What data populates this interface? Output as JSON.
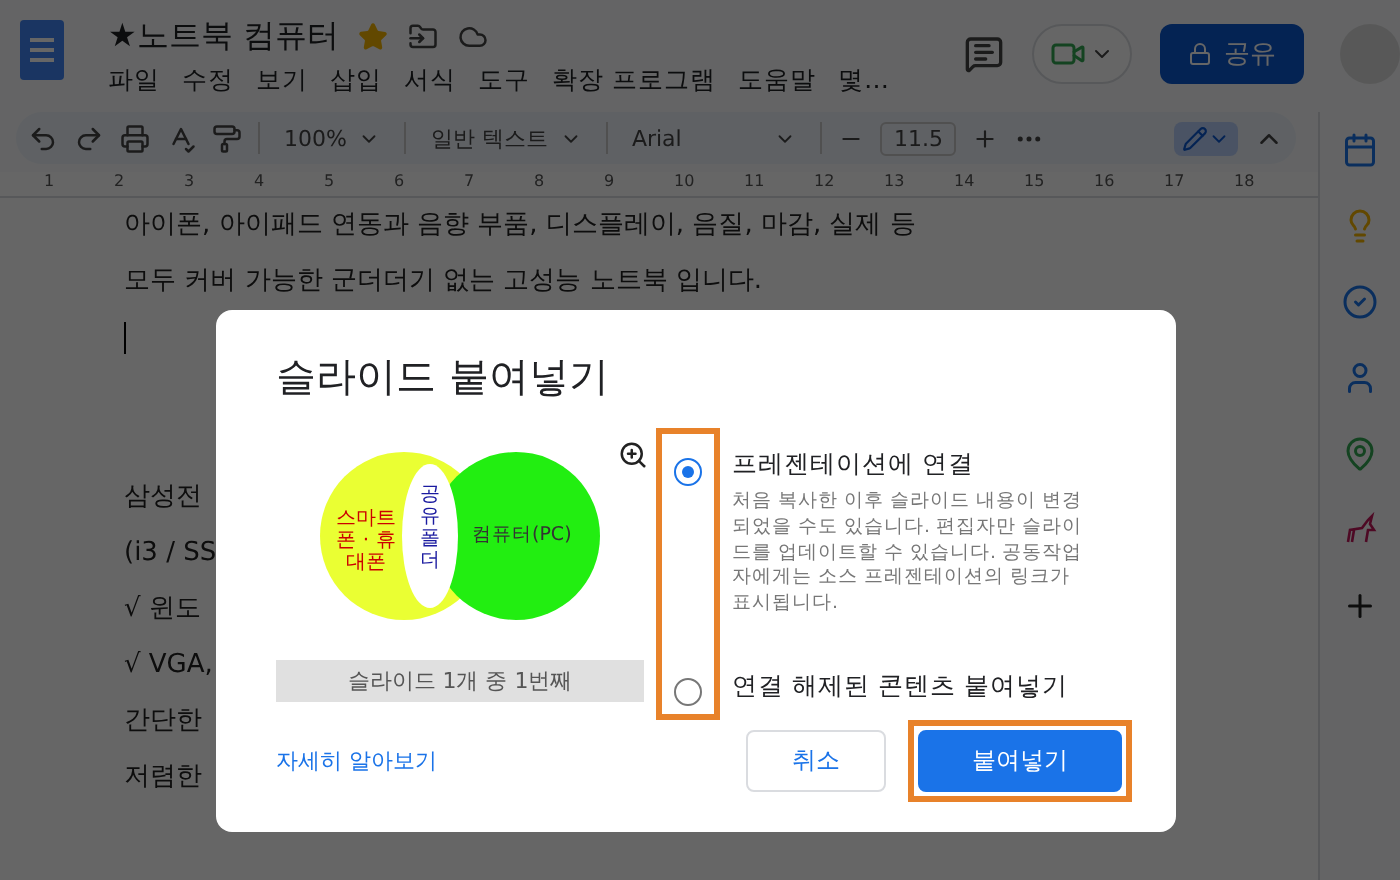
{
  "document": {
    "title": "★노트북 컴퓨터",
    "starred": true,
    "menu": [
      "파일",
      "수정",
      "보기",
      "삽입",
      "서식",
      "도구",
      "확장 프로그램",
      "도움말",
      "몇…"
    ],
    "share_label": "공유"
  },
  "toolbar": {
    "zoom": "100%",
    "style": "일반 텍스트",
    "font": "Arial",
    "font_size": "11.5",
    "edit_mode_selected": true
  },
  "ruler": [
    "1",
    "2",
    "3",
    "4",
    "5",
    "6",
    "7",
    "8",
    "9",
    "10",
    "11",
    "12",
    "13",
    "14",
    "15",
    "16",
    "17",
    "18"
  ],
  "lines_above": [
    "아이폰, 아이패드 연동과 음향 부품, 디스플레이, 음질, 마감, 실제 등",
    "모두 커버 가능한 군더더기 없는 고성능 노트북 입니다."
  ],
  "lines_below": [
    "삼성전",
    "(i3 / SS",
    "√ 윈도",
    "√ VGA,",
    "간단한",
    "저렴한"
  ],
  "dialog": {
    "title": "슬라이드 붙여넣기",
    "preview": {
      "left_label": "스마트폰 · 휴대폰",
      "center_label": "공유폴더",
      "right_label": "컴퓨터(PC)",
      "caption": "슬라이드 1개 중 1번째"
    },
    "radios_highlighted": true,
    "options": [
      {
        "label": "프레젠테이션에 연결",
        "description": "처음 복사한 이후 슬라이드 내용이 변경되었을 수도 있습니다. 편집자만 슬라이드를 업데이트할 수 있습니다. 공동작업자에게는 소스 프레젠테이션의 링크가 표시됩니다.",
        "selected": true
      },
      {
        "label": "연결 해제된 콘텐츠 붙여넣기",
        "selected": false
      }
    ],
    "learn_more": "자세히 알아보기",
    "buttons": [
      {
        "label": "취소",
        "kind": "secondary",
        "highlighted": false
      },
      {
        "label": "붙여넣기",
        "kind": "primary",
        "highlighted": true
      }
    ]
  }
}
